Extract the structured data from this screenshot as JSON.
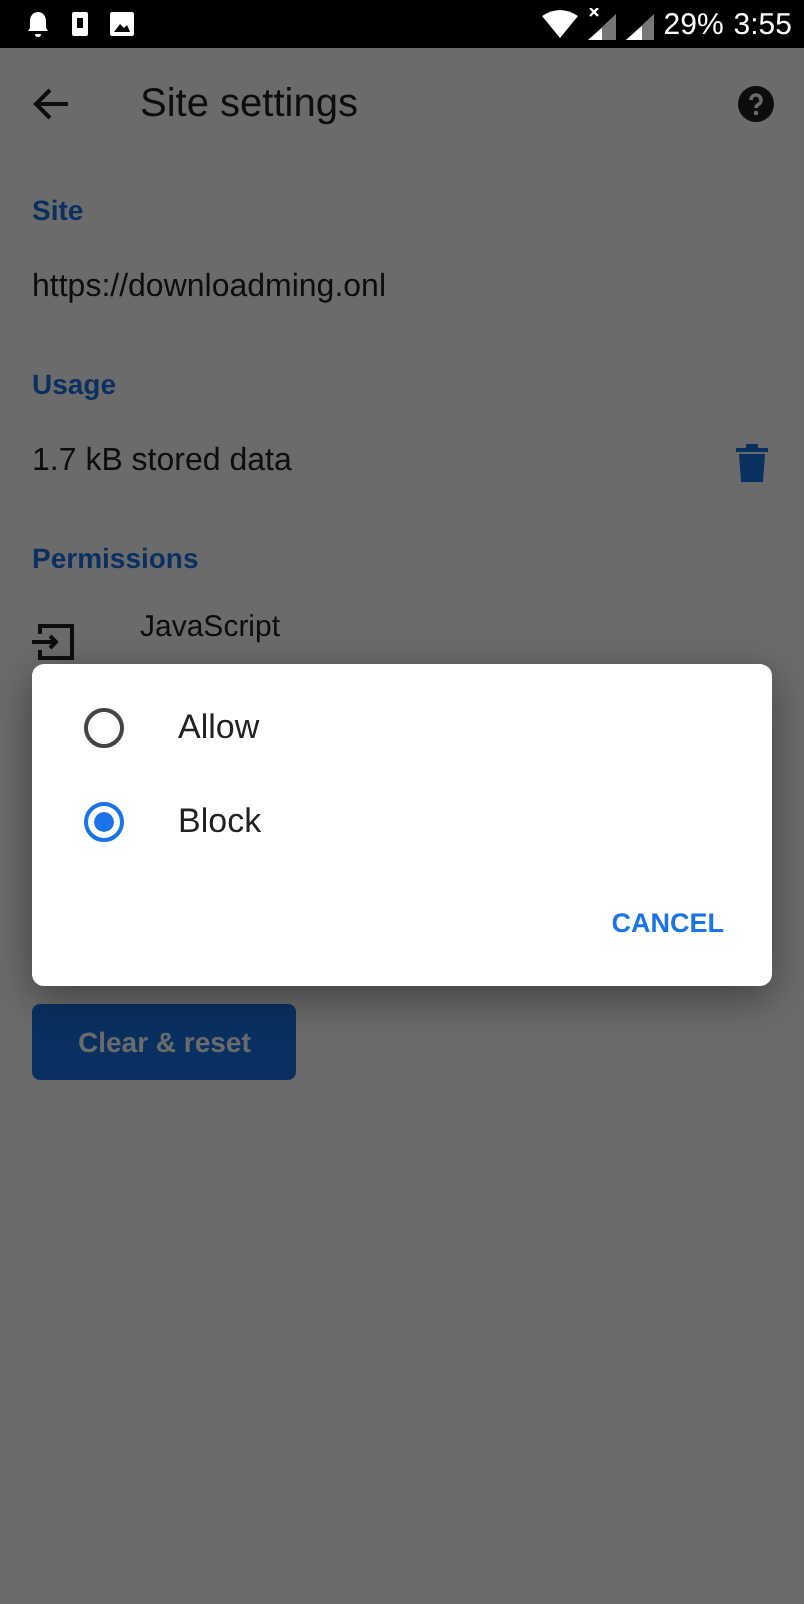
{
  "status_bar": {
    "battery": "29%",
    "time": "3:55"
  },
  "toolbar": {
    "title": "Site settings"
  },
  "sections": [
    {
      "header": "Site",
      "value": "https://downloadming.onl"
    },
    {
      "header": "Usage",
      "value": "1.7 kB stored data"
    },
    {
      "header": "Permissions"
    }
  ],
  "permission": {
    "name": "JavaScript"
  },
  "clear_button": "Clear & reset",
  "dialog": {
    "options": [
      {
        "label": "Allow",
        "selected": false
      },
      {
        "label": "Block",
        "selected": true
      }
    ],
    "cancel": "CANCEL"
  }
}
